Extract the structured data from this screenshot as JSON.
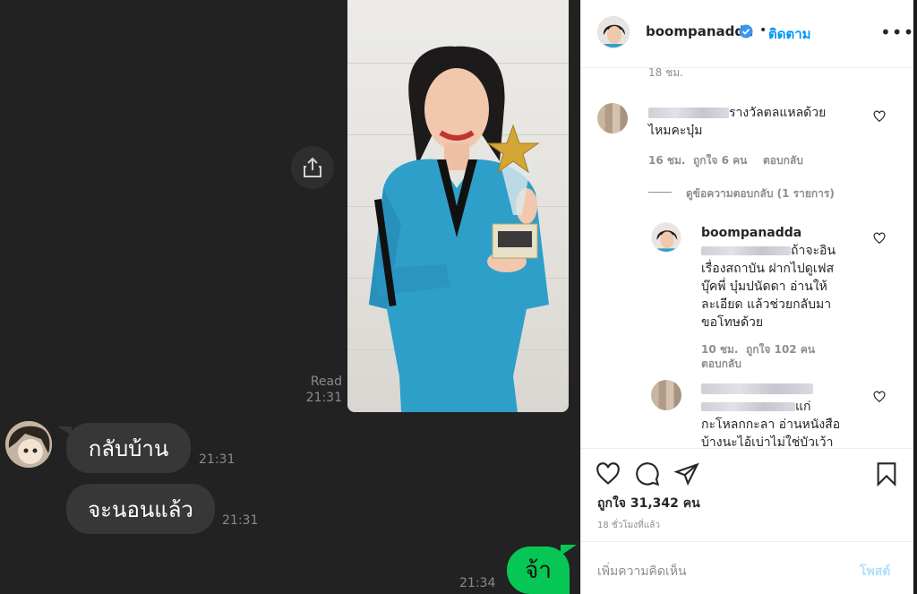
{
  "chat": {
    "read_label": "Read",
    "read_time": "21:31",
    "messages": [
      {
        "text": "กลับบ้าน",
        "time": "21:31"
      },
      {
        "text": "จะนอนแล้ว",
        "time": "21:31"
      }
    ],
    "my_message": {
      "text": "จ้า",
      "time": "21:34"
    }
  },
  "instagram": {
    "username": "boompanadda",
    "dot": "•",
    "follow_label": "ติดตาม",
    "more_icon": "more-horizontal-icon",
    "top_timestamp": "18 ชม.",
    "comment1": {
      "text_line1": "รางวัลตลแหลด้วย",
      "text_line2": "ไหมคะบุ๋ม",
      "time": "16 ชม.",
      "likes": "ถูกใจ 6 คน",
      "reply": "ตอบกลับ"
    },
    "view_replies": "ดูข้อความตอบกลับ (1 รายการ)",
    "reply": {
      "username": "boompanadda",
      "lines": [
        "ถ้าจะอิน",
        "เรื่องสถาบัน ฝากไปดูเฟส",
        "บุ๊คพี่ บุ๋มปนัดดา อ่านให้",
        "ละเอียด แล้วช่วยกลับมา",
        "ขอโทษด้วย"
      ],
      "time": "10 ชม.",
      "likes": "ถูกใจ 102 คน",
      "reply_label": "ตอบกลับ"
    },
    "comment3": {
      "lines": [
        "แก่",
        "กะโหลกกะลา อ่านหนังสือ",
        "บ้างนะไอ้เบ่าไม่ใช่บัวเว้า"
      ]
    },
    "total_likes": "ถูกใจ 31,342 คน",
    "posted_ago": "18 ชั่วโมงที่แล้ว",
    "add_comment_placeholder": "เพิ่มความคิดเห็น",
    "post_label": "โพสต์",
    "colors": {
      "accent": "#0095f6",
      "line_green": "#06c755"
    }
  }
}
